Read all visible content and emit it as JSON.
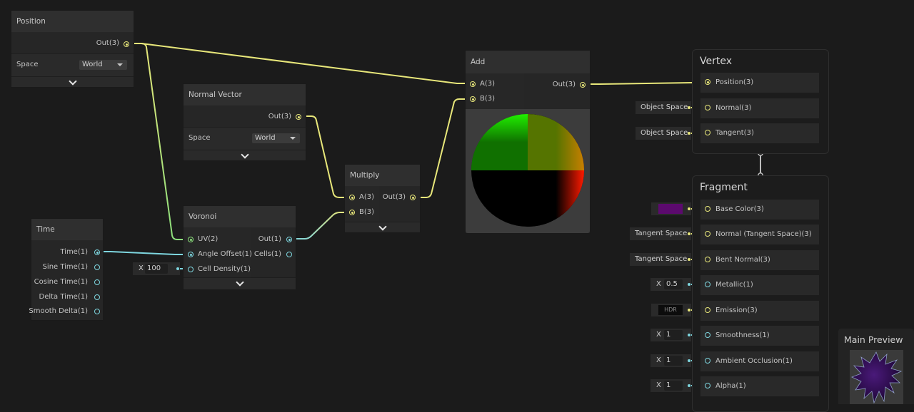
{
  "colors": {
    "vector3": "#e8e77a",
    "vector1": "#7ed6df",
    "vector2": "#8ce07c",
    "base_color_swatch": "#5c0a6e",
    "canvas": "#1b1b1b"
  },
  "nodes": {
    "position": {
      "title": "Position",
      "out": "Out(3)",
      "space_label": "Space",
      "space_value": "World"
    },
    "normal_vector": {
      "title": "Normal Vector",
      "out": "Out(3)",
      "space_label": "Space",
      "space_value": "World"
    },
    "time": {
      "title": "Time",
      "outputs": [
        "Time(1)",
        "Sine Time(1)",
        "Cosine Time(1)",
        "Delta Time(1)",
        "Smooth Delta(1)"
      ]
    },
    "voronoi": {
      "title": "Voronoi",
      "inputs": [
        "UV(2)",
        "Angle Offset(1)",
        "Cell Density(1)"
      ],
      "outputs": [
        "Out(1)",
        "Cells(1)"
      ],
      "cell_density_axis": "X",
      "cell_density_value": "100"
    },
    "multiply": {
      "title": "Multiply",
      "inputs": [
        "A(3)",
        "B(3)"
      ],
      "out": "Out(3)"
    },
    "add": {
      "title": "Add",
      "inputs": [
        "A(3)",
        "B(3)"
      ],
      "out": "Out(3)"
    }
  },
  "master": {
    "vertex": {
      "title": "Vertex",
      "slots": [
        {
          "label": "Position(3)",
          "inline": ""
        },
        {
          "label": "Normal(3)",
          "inline": "Object Space"
        },
        {
          "label": "Tangent(3)",
          "inline": "Object Space"
        }
      ]
    },
    "fragment": {
      "title": "Fragment",
      "slots": [
        {
          "label": "Base Color(3)",
          "inline_type": "color"
        },
        {
          "label": "Normal (Tangent Space)(3)",
          "inline": "Tangent Space"
        },
        {
          "label": "Bent Normal(3)",
          "inline": "Tangent Space"
        },
        {
          "label": "Metallic(1)",
          "axis": "X",
          "value": "0.5"
        },
        {
          "label": "Emission(3)",
          "inline": "HDR"
        },
        {
          "label": "Smoothness(1)",
          "axis": "X",
          "value": "1"
        },
        {
          "label": "Ambient Occlusion(1)",
          "axis": "X",
          "value": "1"
        },
        {
          "label": "Alpha(1)",
          "axis": "X",
          "value": "1"
        }
      ]
    }
  },
  "main_preview": {
    "title": "Main Preview"
  }
}
